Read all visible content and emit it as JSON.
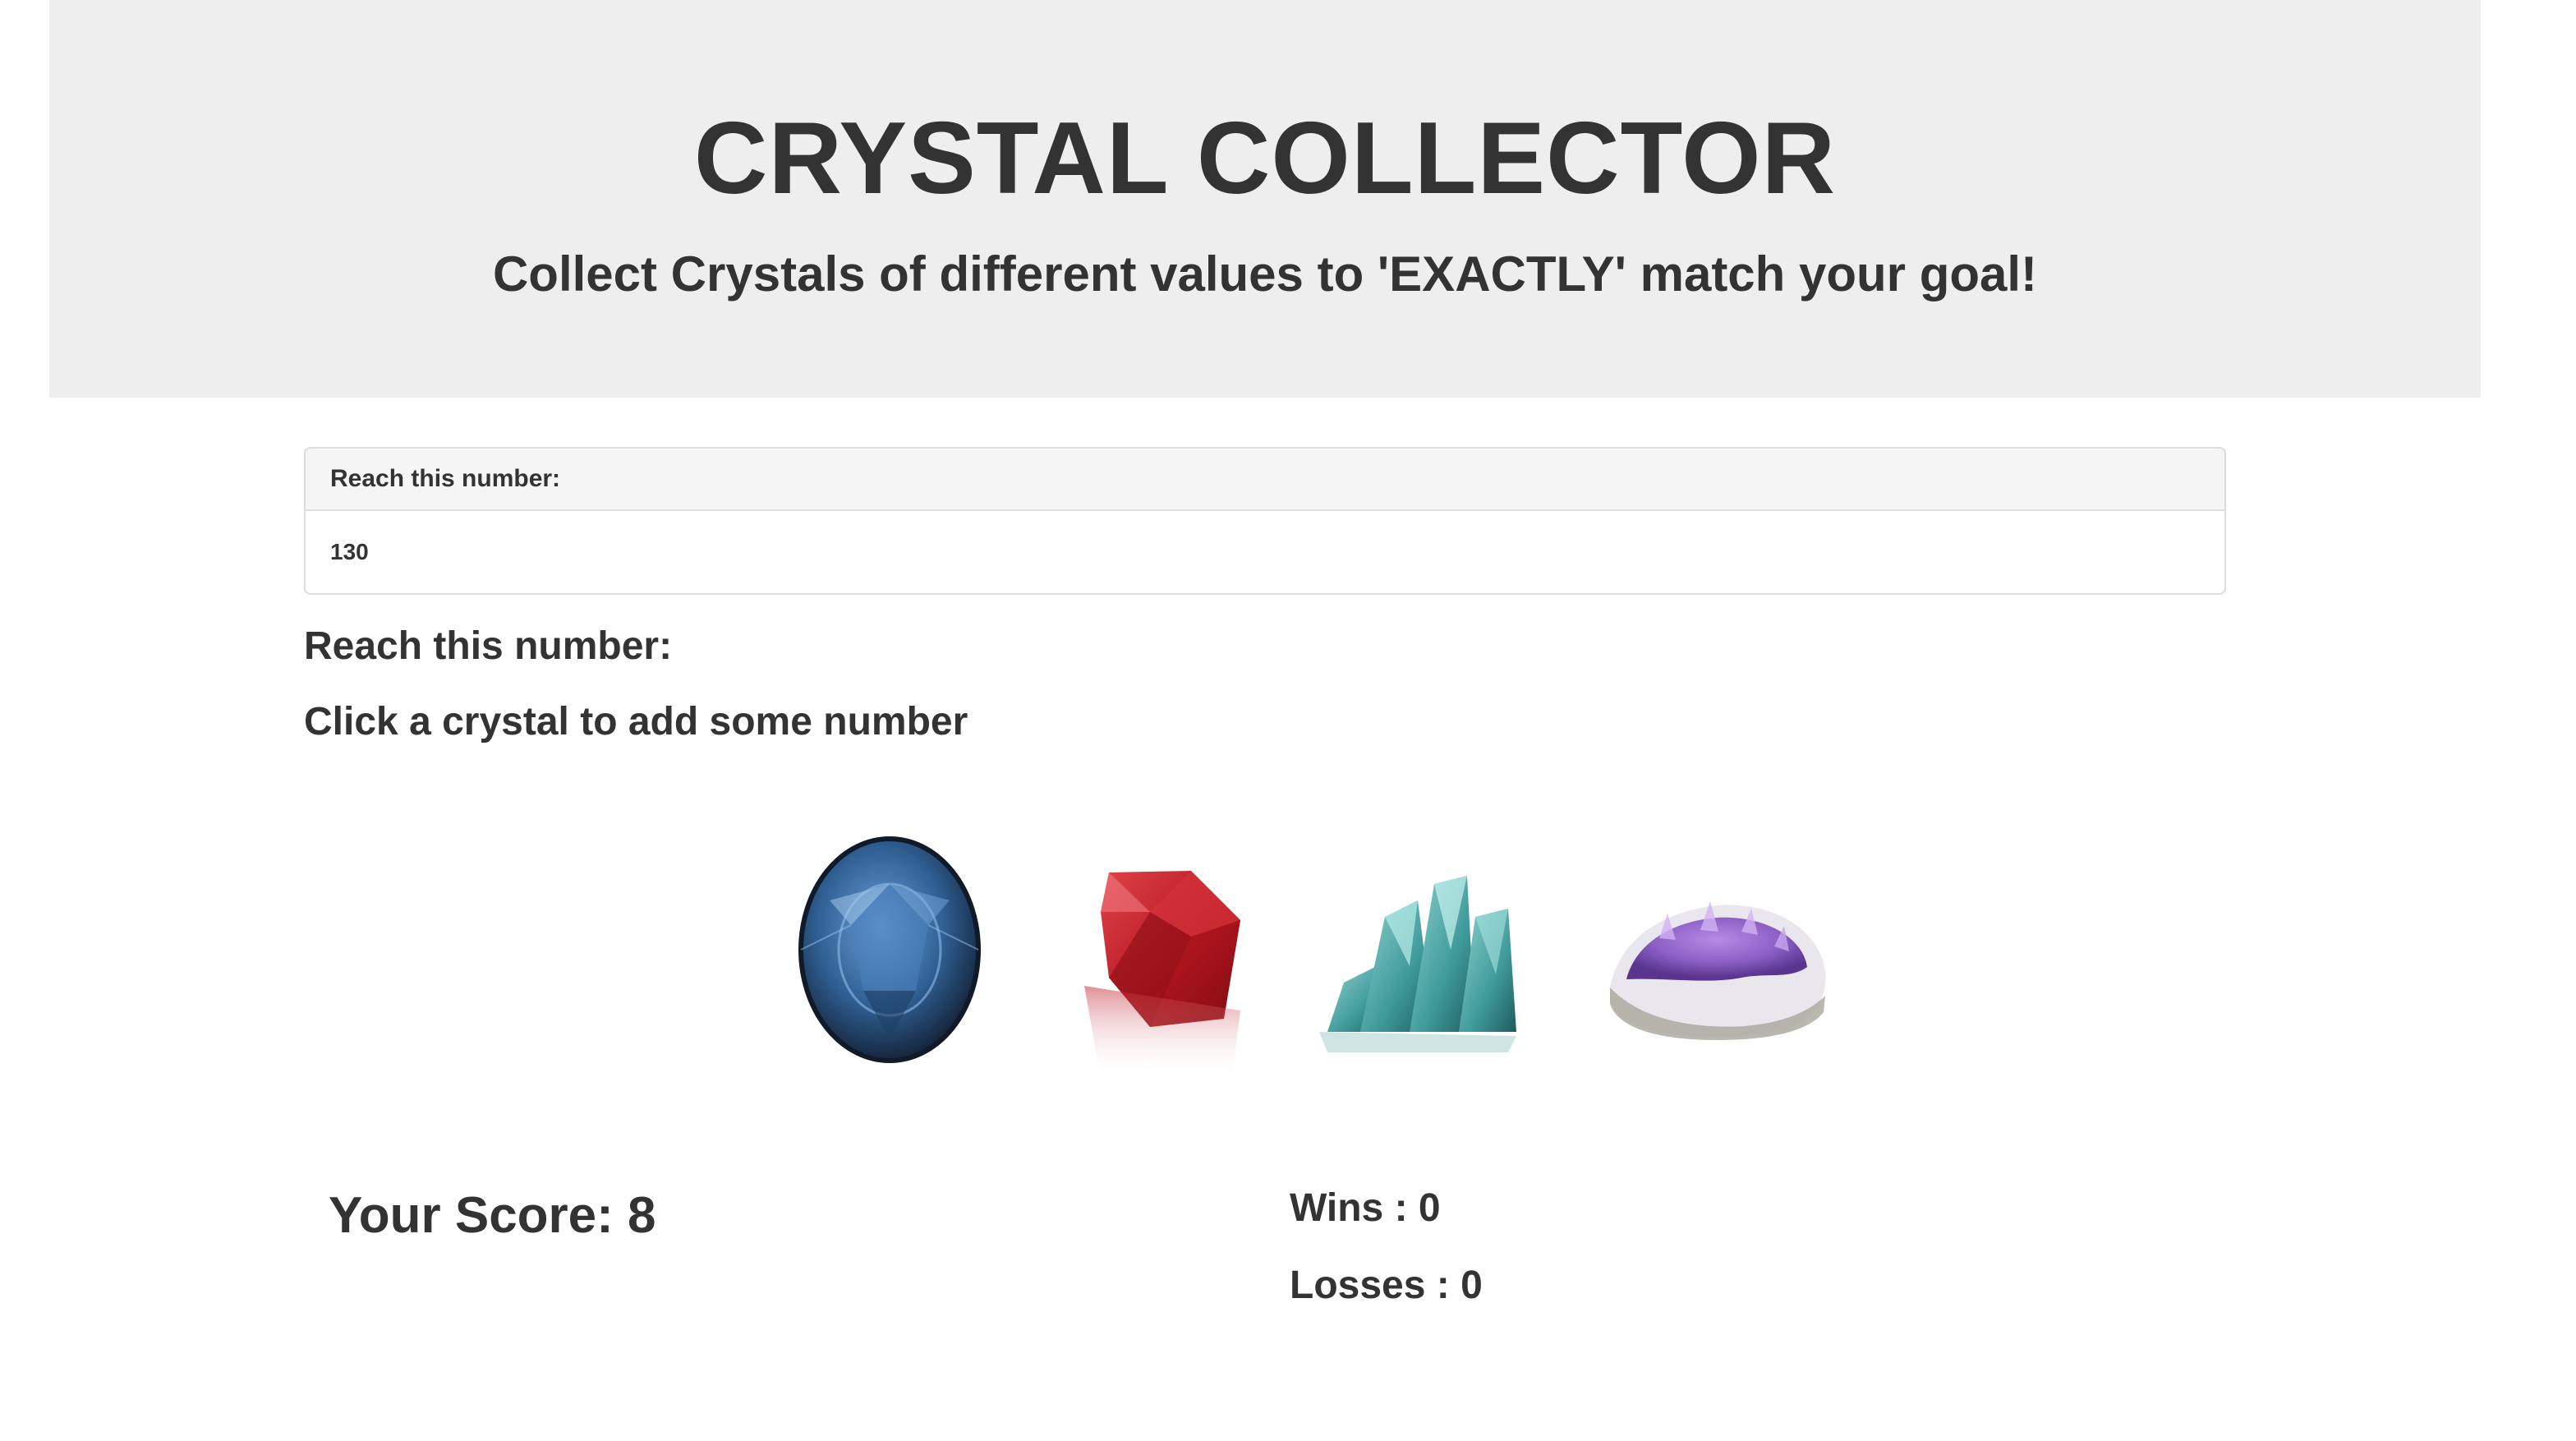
{
  "header": {
    "title": "CRYSTAL COLLECTOR",
    "subtitle": "Collect Crystals of different values to 'EXACTLY' match your goal!"
  },
  "target_panel": {
    "heading": "Reach this number:",
    "value": "130"
  },
  "instructions": {
    "reach_label": "Reach this number:",
    "click_label": "Click a crystal to add some number"
  },
  "crystals": [
    {
      "name": "blue-sapphire",
      "icon": "blue-oval-gem-icon",
      "color": "#2f5f93"
    },
    {
      "name": "red-ruby",
      "icon": "red-diamond-gem-icon",
      "color": "#b3161f"
    },
    {
      "name": "teal-quartz",
      "icon": "teal-crystal-cluster-icon",
      "color": "#3f9a9a"
    },
    {
      "name": "purple-amethyst",
      "icon": "purple-amethyst-geode-icon",
      "color": "#8b5fc4"
    }
  ],
  "scoreboard": {
    "score_text": "Your Score: 8",
    "wins_text": "Wins : 0",
    "losses_text": "Losses : 0"
  }
}
